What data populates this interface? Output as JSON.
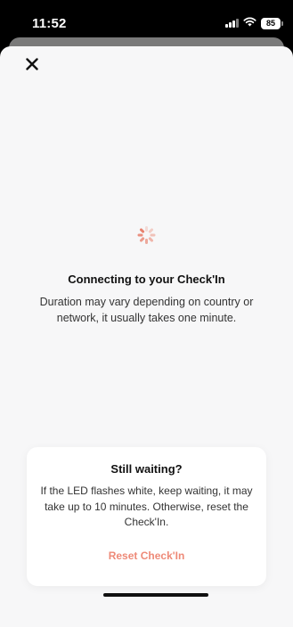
{
  "status_bar": {
    "time": "11:52",
    "battery": "85",
    "icons": [
      "signal-icon",
      "wifi-icon",
      "battery-icon"
    ]
  },
  "sheet": {
    "close_icon": "close-icon",
    "spinner_icon": "loading-spinner-icon",
    "spinner_color": "#e8826f",
    "connecting_title": "Connecting to your Check'In",
    "connecting_description": "Duration may vary depending on country or network, it usually takes one minute."
  },
  "waiting_card": {
    "title": "Still waiting?",
    "description": "If the LED flashes white, keep waiting, it may take up to 10 minutes. Otherwise, reset the Check'In.",
    "reset_label": "Reset Check'In",
    "accent_color": "#ee8a78"
  }
}
